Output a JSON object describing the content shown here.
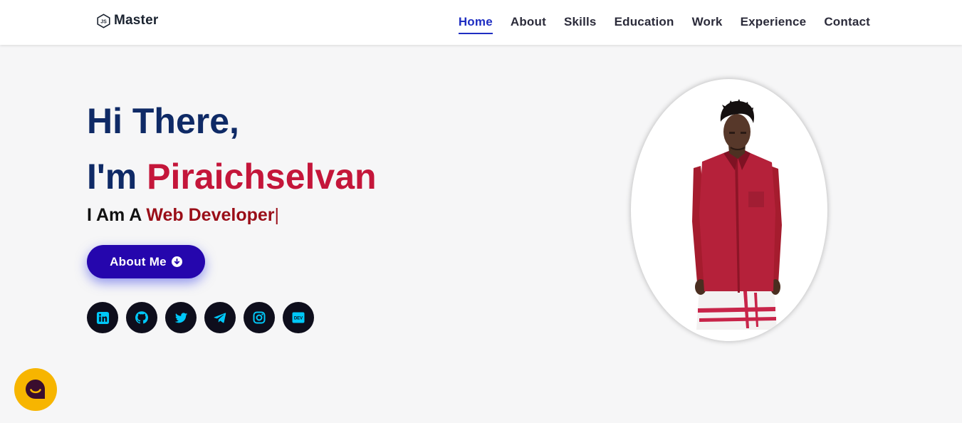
{
  "header": {
    "logo_text": "Master",
    "nav": [
      {
        "label": "Home",
        "active": true
      },
      {
        "label": "About",
        "active": false
      },
      {
        "label": "Skills",
        "active": false
      },
      {
        "label": "Education",
        "active": false
      },
      {
        "label": "Work",
        "active": false
      },
      {
        "label": "Experience",
        "active": false
      },
      {
        "label": "Contact",
        "active": false
      }
    ]
  },
  "hero": {
    "line1": "Hi There,",
    "line2_prefix": "I'm ",
    "name": "Piraichselvan",
    "subtitle_prefix": "I Am A ",
    "role": "Web Developer",
    "caret": "|",
    "button_label": "About Me"
  },
  "socials": [
    {
      "name": "linkedin"
    },
    {
      "name": "github"
    },
    {
      "name": "twitter"
    },
    {
      "name": "telegram"
    },
    {
      "name": "instagram"
    },
    {
      "name": "dev"
    }
  ],
  "dev_badge_text": "DEV",
  "colors": {
    "accent": "#1f2ec2",
    "name_red": "#c4163a",
    "title_navy": "#0f2a66",
    "button": "#2506ad",
    "social_bg": "#0e0e1c",
    "social_icon": "#00c8f8",
    "chat_bg": "#f7b500"
  }
}
